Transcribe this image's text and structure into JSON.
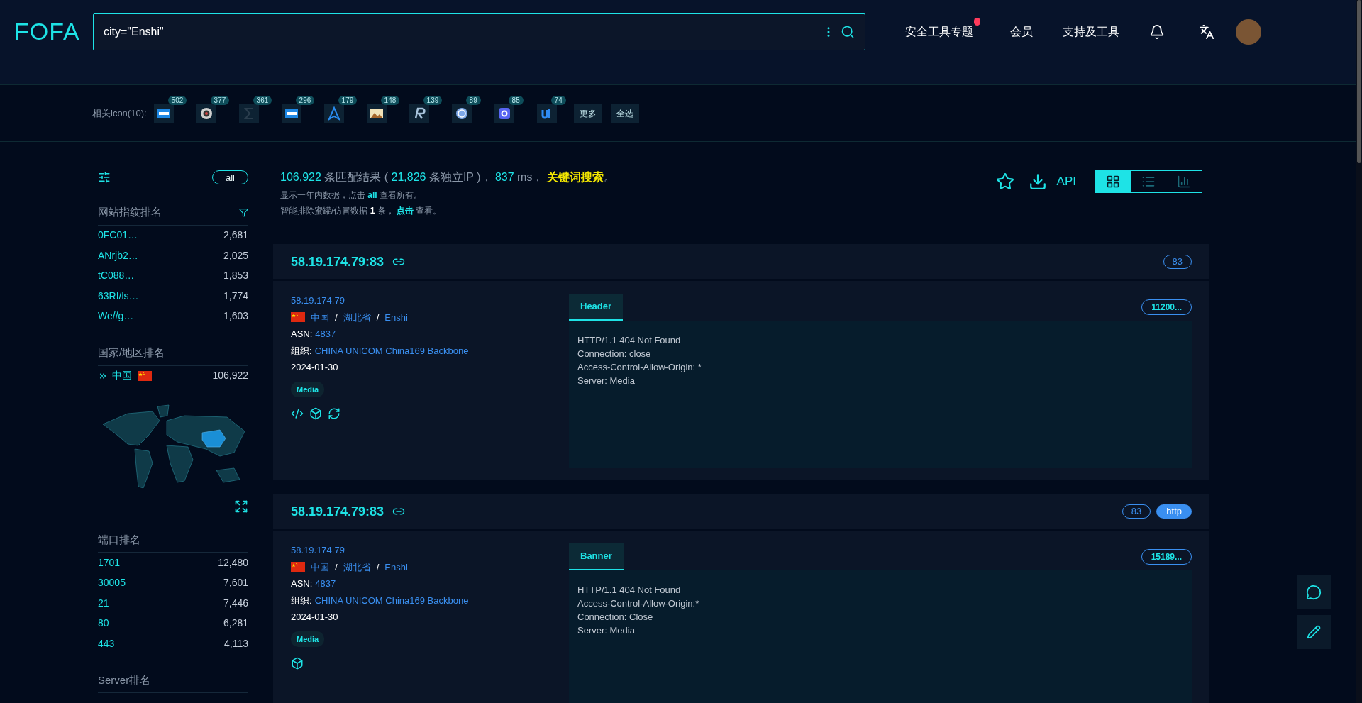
{
  "header": {
    "logo": "FOFA",
    "search": {
      "value": "city=\"Enshi\""
    },
    "nav": [
      {
        "label": "安全工具专题",
        "hot": true
      },
      {
        "label": "会员",
        "hot": false
      },
      {
        "label": "支持及工具",
        "hot": false
      }
    ]
  },
  "icon_bar": {
    "label": "相关icon(10):",
    "icons": [
      {
        "kind": "dsm",
        "count": "502"
      },
      {
        "kind": "camera",
        "count": "377"
      },
      {
        "kind": "sigma",
        "count": "361"
      },
      {
        "kind": "dsm",
        "count": "296"
      },
      {
        "kind": "arrow",
        "count": "179"
      },
      {
        "kind": "photo",
        "count": "148"
      },
      {
        "kind": "r",
        "count": "139"
      },
      {
        "kind": "qb",
        "count": "89"
      },
      {
        "kind": "robot",
        "count": "85"
      },
      {
        "kind": "ui",
        "count": "74"
      }
    ],
    "buttons": [
      "更多",
      "全选"
    ]
  },
  "sidebar": {
    "all_button": "all",
    "sections": [
      {
        "kind": "list",
        "title": "网站指纹排名",
        "filter": true,
        "items": [
          {
            "label": "0FC01…",
            "count": "2,681"
          },
          {
            "label": "ANrjb2…",
            "count": "2,025"
          },
          {
            "label": "tC088…",
            "count": "1,853"
          },
          {
            "label": "63Rf/ls…",
            "count": "1,774"
          },
          {
            "label": "We//g…",
            "count": "1,603"
          }
        ]
      },
      {
        "kind": "country",
        "title": "国家/地区排名",
        "filter": false,
        "items": [
          {
            "label": "中国",
            "count": "106,922"
          }
        ]
      },
      {
        "kind": "list",
        "title": "端口排名",
        "filter": false,
        "items": [
          {
            "label": "1701",
            "count": "12,480"
          },
          {
            "label": "30005",
            "count": "7,601"
          },
          {
            "label": "21",
            "count": "7,446"
          },
          {
            "label": "80",
            "count": "6,281"
          },
          {
            "label": "443",
            "count": "4,113"
          }
        ]
      },
      {
        "kind": "list",
        "title": "Server排名",
        "filter": false
      }
    ]
  },
  "summary": {
    "line1": [
      {
        "kind": "number",
        "text": "106,922"
      },
      {
        "kind": "plain",
        "text": " 条匹配结果 ( "
      },
      {
        "kind": "number",
        "text": "21,826"
      },
      {
        "kind": "plain",
        "text": " 条独立IP )， "
      },
      {
        "kind": "number",
        "text": "837"
      },
      {
        "kind": "plain",
        "text": " ms， "
      },
      {
        "kind": "link",
        "text": "关键词搜索"
      },
      {
        "kind": "plain",
        "text": "。"
      }
    ],
    "line2": [
      {
        "kind": "plain",
        "text": "显示一年内数据，点击 "
      },
      {
        "kind": "link",
        "text": "all"
      },
      {
        "kind": "plain",
        "text": " 查看所有。"
      }
    ],
    "line3": [
      {
        "kind": "plain",
        "text": "智能排除蜜罐/仿冒数据 "
      },
      {
        "kind": "bold",
        "text": "1"
      },
      {
        "kind": "plain",
        "text": " 条， "
      },
      {
        "kind": "link",
        "text": "点击"
      },
      {
        "kind": "plain",
        "text": " 查看。"
      }
    ]
  },
  "toolbar": {
    "api": "API",
    "views": [
      {
        "kind": "grid",
        "selected": true
      },
      {
        "kind": "list",
        "selected": false
      },
      {
        "kind": "chart",
        "selected": false
      }
    ]
  },
  "results": [
    {
      "host": "58.19.174.79:83",
      "port": "83",
      "ip": "58.19.174.79",
      "country": "中国",
      "sep1": "/",
      "province": "湖北省",
      "sep2": "/",
      "city": "Enshi",
      "asn_label": "ASN:",
      "asn": "4837",
      "org_label": "组织:",
      "org": "CHINA UNICOM China169 Backbone",
      "date": "2024-01-30",
      "tag": "Media",
      "actions": [
        {
          "kind": "code"
        },
        {
          "kind": "cube"
        },
        {
          "kind": "refresh"
        }
      ],
      "tab": "Header",
      "size": "11200...",
      "body": [
        "HTTP/1.1 404 Not Found",
        "Connection: close",
        "Access-Control-Allow-Origin: *",
        "Server: Media"
      ]
    },
    {
      "host": "58.19.174.79:83",
      "port": "83",
      "protocol": "http",
      "ip": "58.19.174.79",
      "country": "中国",
      "sep1": "/",
      "province": "湖北省",
      "sep2": "/",
      "city": "Enshi",
      "asn_label": "ASN:",
      "asn": "4837",
      "org_label": "组织:",
      "org": "CHINA UNICOM China169 Backbone",
      "date": "2024-01-30",
      "tag": "Media",
      "actions": [
        {
          "kind": "cube"
        }
      ],
      "tab": "Banner",
      "size": "15189...",
      "body": [
        "HTTP/1.1 404 Not Found",
        "Access-Control-Allow-Origin:*",
        "Connection: Close",
        "Server: Media"
      ]
    }
  ],
  "float_buttons": [
    {
      "kind": "chat"
    },
    {
      "kind": "edit"
    }
  ]
}
